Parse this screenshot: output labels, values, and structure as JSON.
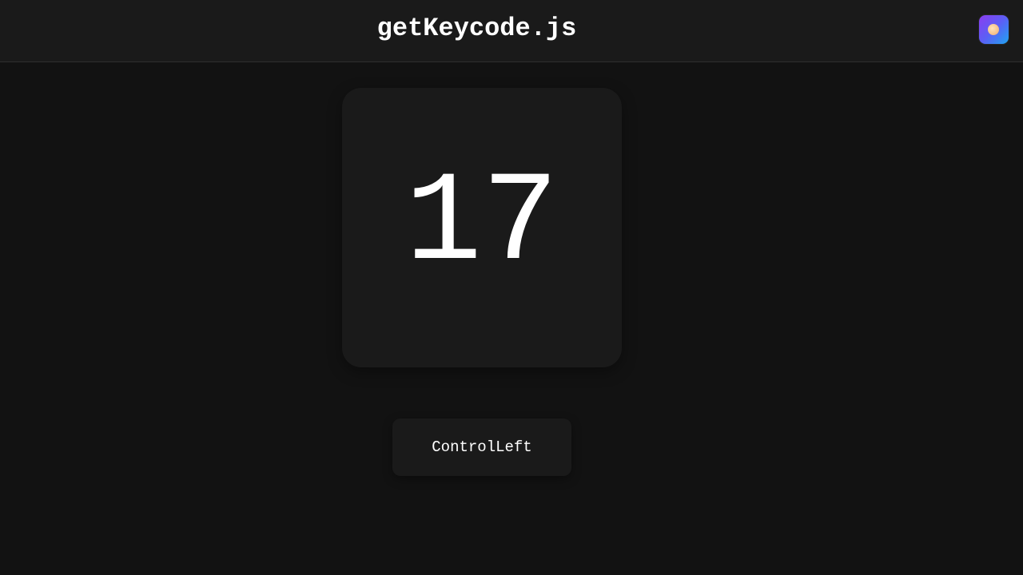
{
  "header": {
    "title": "getKeycode.js",
    "app_icon": "app-logo-icon"
  },
  "key": {
    "keycode": "17",
    "code": "ControlLeft"
  },
  "colors": {
    "background": "#121212",
    "card": "#1a1a1a",
    "text": "#ffffff",
    "icon_gradient_start": "#8b3cf0",
    "icon_gradient_end": "#1fa4f0"
  }
}
